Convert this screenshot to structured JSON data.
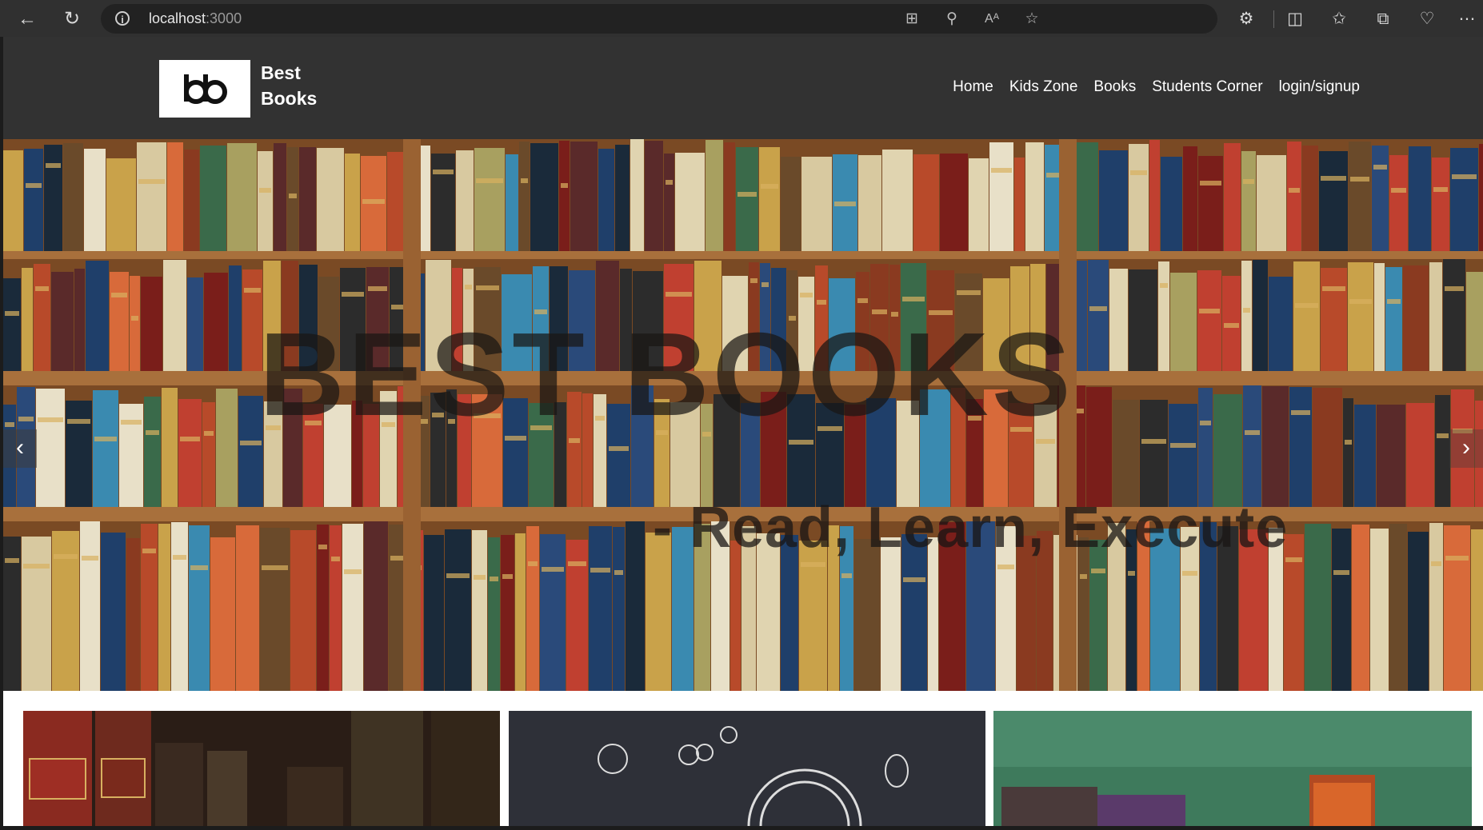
{
  "browser": {
    "url_host": "localhost",
    "url_port": ":3000",
    "icons": [
      "back-icon",
      "refresh-icon",
      "info-icon",
      "apps-icon",
      "zoom-icon",
      "read-aloud-icon",
      "favorite-icon",
      "extensions-icon",
      "split-screen-icon",
      "favorites-icon",
      "collections-icon",
      "browser-essentials-icon",
      "more-icon"
    ]
  },
  "navbar": {
    "brand": "Best Books",
    "links": [
      "Home",
      "Kids Zone",
      "Books",
      "Students Corner",
      "login/signup"
    ]
  },
  "hero": {
    "title": "BEST BOOKS",
    "subtitle": "- Read, Learn, Execute",
    "prev": "‹",
    "next": "›"
  },
  "cards": [
    "old-books-image",
    "chalkboard-doodle-image",
    "green-board-books-image"
  ],
  "colors": {
    "navbar_bg": "#323232",
    "chrome_bg": "#303030"
  }
}
